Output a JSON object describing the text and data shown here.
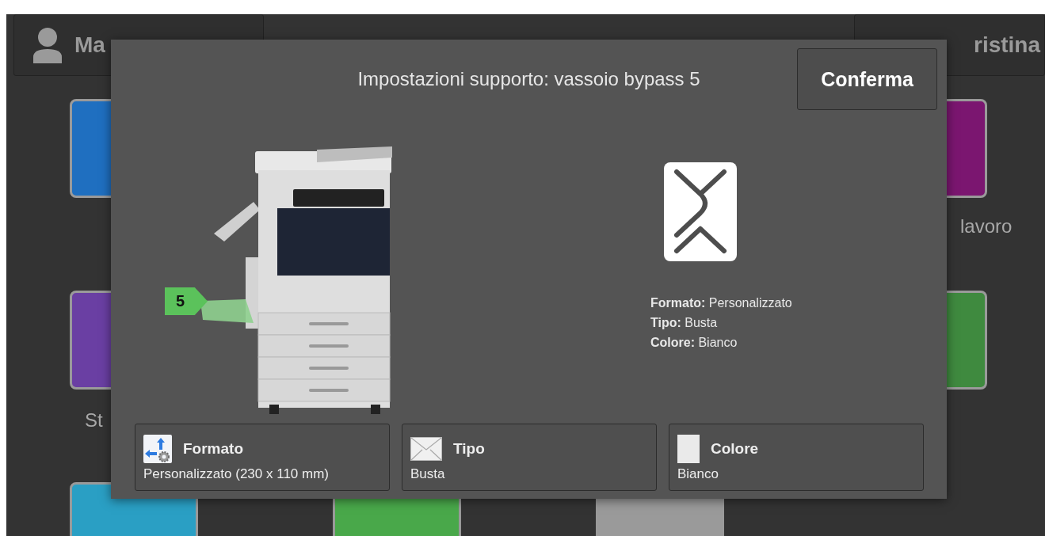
{
  "home": {
    "user_button": {
      "label": "Ma"
    },
    "reset_button": {
      "label": "ristina"
    },
    "app_rows": [
      {
        "apps": [
          {
            "color": "#1f6fc0"
          },
          {
            "color": "#7b1670",
            "label": "lavoro"
          }
        ]
      },
      {
        "apps": [
          {
            "color": "#6a3fa3",
            "label": "St"
          },
          {
            "color": "#3f8a3f"
          }
        ]
      },
      {
        "apps": [
          {
            "color": "#2a9fc4"
          },
          {
            "color": "#49a84a"
          },
          {
            "color": "#9a9a9a"
          }
        ]
      }
    ]
  },
  "dialog": {
    "title": "Impostazioni supporto: vassoio bypass 5",
    "confirm_button": "Conferma",
    "tray_badge": "5",
    "summary": [
      "**Formato:** Personalizzato",
      "**Tipo:** Busta",
      "**Colore:** Bianco"
    ],
    "settings": [
      {
        "kind": "size",
        "label": "Formato",
        "value": "Personalizzato (230 x 110 mm)"
      },
      {
        "kind": "type",
        "label": "Tipo",
        "value": "Busta"
      },
      {
        "kind": "color",
        "label": "Colore",
        "value": "Bianco"
      }
    ]
  }
}
